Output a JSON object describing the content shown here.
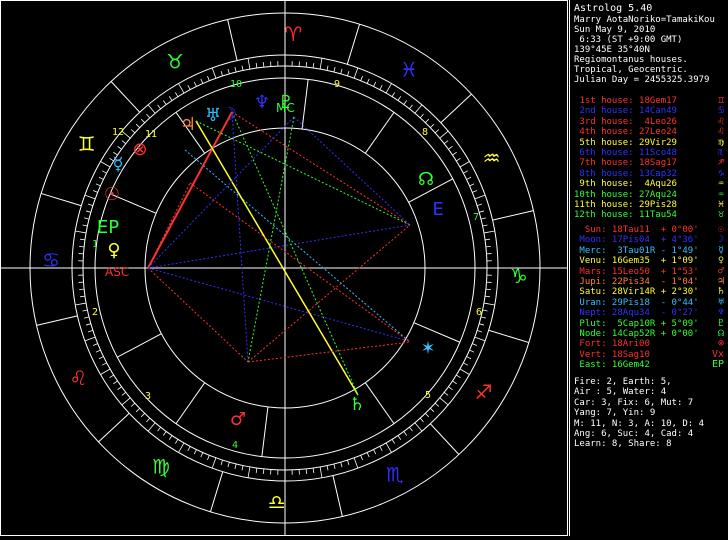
{
  "app": {
    "title": "Astrolog 5.40"
  },
  "chart_info": {
    "name": "Marry AotaNoriko=TamakiKou",
    "date": "Sun May 9, 2010",
    "time": " 6:33 (ST +9:00 GMT)",
    "location": "139°45E 35°40N",
    "house_system": "Regiomontanus houses.",
    "zodiac": "Tropical, Geocentric.",
    "julian": "Julian Day = 2455325.3979"
  },
  "houses": [
    {
      "label": "1st house:",
      "value": "18Gem17",
      "glyph": "♊",
      "color": "#ff3030"
    },
    {
      "label": "2nd house:",
      "value": "14Can49",
      "glyph": "♋",
      "color": "#3030ff"
    },
    {
      "label": "3rd house:",
      "value": " 4Leo26",
      "glyph": "♌",
      "color": "#ff3030"
    },
    {
      "label": "4th house:",
      "value": "27Leo24",
      "glyph": "♌",
      "color": "#ff3030"
    },
    {
      "label": "5th house:",
      "value": "29Vir29",
      "glyph": "♍",
      "color": "#ffff30"
    },
    {
      "label": "6th house:",
      "value": "11Sco48",
      "glyph": "♏",
      "color": "#3030ff"
    },
    {
      "label": "7th house:",
      "value": "18Sag17",
      "glyph": "♐",
      "color": "#ff3030"
    },
    {
      "label": "8th house:",
      "value": "13Cap32",
      "glyph": "♑",
      "color": "#3030ff"
    },
    {
      "label": "9th house:",
      "value": " 4Aqu26",
      "glyph": "♒",
      "color": "#ffff30"
    },
    {
      "label": "10th house:",
      "value": "27Aqu24",
      "glyph": "♒",
      "color": "#30ff30"
    },
    {
      "label": "11th house:",
      "value": "29Pis28",
      "glyph": "♓",
      "color": "#ffff30"
    },
    {
      "label": "12th house:",
      "value": "11Tau54",
      "glyph": "♉",
      "color": "#30ff30"
    }
  ],
  "planets": [
    {
      "label": "Sun:",
      "value": "18Tau11",
      "speed": " + 0°00'",
      "glyph": "☉",
      "color": "#ff3030"
    },
    {
      "label": "Moon:",
      "value": "17Pis04",
      "speed": " + 4°36'",
      "glyph": "☽",
      "color": "#3030ff"
    },
    {
      "label": "Merc:",
      "value": " 3Tau01R",
      "speed": " - 1°49'",
      "glyph": "☿",
      "color": "#30c0ff"
    },
    {
      "label": "Venu:",
      "value": "16Gem35",
      "speed": " + 1°09'",
      "glyph": "♀",
      "color": "#ffff30"
    },
    {
      "label": "Mars:",
      "value": "15Leo50",
      "speed": " + 1°53'",
      "glyph": "♂",
      "color": "#ff3030"
    },
    {
      "label": "Jupi:",
      "value": "22Pis34",
      "speed": " - 1°04'",
      "glyph": "♃",
      "color": "#ff8030"
    },
    {
      "label": "Satu:",
      "value": "28Vir14R",
      "speed": " + 2°30'",
      "glyph": "♄",
      "color": "#ffff30"
    },
    {
      "label": "Uran:",
      "value": "29Pis18",
      "speed": " - 0°44'",
      "glyph": "♅",
      "color": "#30c0ff"
    },
    {
      "label": "Nept:",
      "value": "28Aqu34",
      "speed": " - 0°27'",
      "glyph": "♆",
      "color": "#3030ff"
    },
    {
      "label": "Plut:",
      "value": " 5Cap10R",
      "speed": " + 5°09'",
      "glyph": "♇",
      "color": "#30ff30"
    },
    {
      "label": "Node:",
      "value": "14Cap52R",
      "speed": " + 0°00'",
      "glyph": "☊",
      "color": "#30ff30"
    },
    {
      "label": "Fort:",
      "value": "18Ari00",
      "speed": "",
      "glyph": "⊗",
      "color": "#ff3030"
    },
    {
      "label": "Vert:",
      "value": "18Sag10",
      "speed": "",
      "glyph": "Vx",
      "color": "#ff3030"
    },
    {
      "label": "East:",
      "value": "16Gem42",
      "speed": "",
      "glyph": "EP",
      "color": "#30ff30"
    }
  ],
  "summary": [
    "Fire: 2, Earth: 5,",
    "Air : 5, Water: 4",
    "Car: 3, Fix: 6, Mut: 7",
    "Yang: 7, Yin: 9",
    "M: 11, N: 3, A: 10, D: 4",
    "Ang: 6, Suc: 4, Cad: 4",
    "Learn: 8, Share: 8"
  ],
  "signs": [
    {
      "glyph": "♓",
      "color": "#3030ff"
    },
    {
      "glyph": "♒",
      "color": "#ffff30"
    },
    {
      "glyph": "♑",
      "color": "#30ff30"
    },
    {
      "glyph": "♐",
      "color": "#ff3030"
    },
    {
      "glyph": "♏",
      "color": "#3030ff"
    },
    {
      "glyph": "♎",
      "color": "#ffff30"
    },
    {
      "glyph": "♍",
      "color": "#30ff30"
    },
    {
      "glyph": "♌",
      "color": "#ff3030"
    },
    {
      "glyph": "♋",
      "color": "#3030ff"
    },
    {
      "glyph": "♊",
      "color": "#ffff30"
    },
    {
      "glyph": "♉",
      "color": "#30ff30"
    },
    {
      "glyph": "♈",
      "color": "#ff3030"
    }
  ],
  "house_numbers": [
    "10",
    "9",
    "8",
    "7",
    "6",
    "5",
    "4",
    "3",
    "2",
    "1",
    "12",
    "11"
  ],
  "colors": {
    "white": "#ffffff",
    "red": "#ff3030",
    "blue": "#3030ff",
    "green": "#30ff30",
    "yellow": "#ffff30",
    "cyan": "#30c0ff",
    "orange": "#ff8030"
  }
}
